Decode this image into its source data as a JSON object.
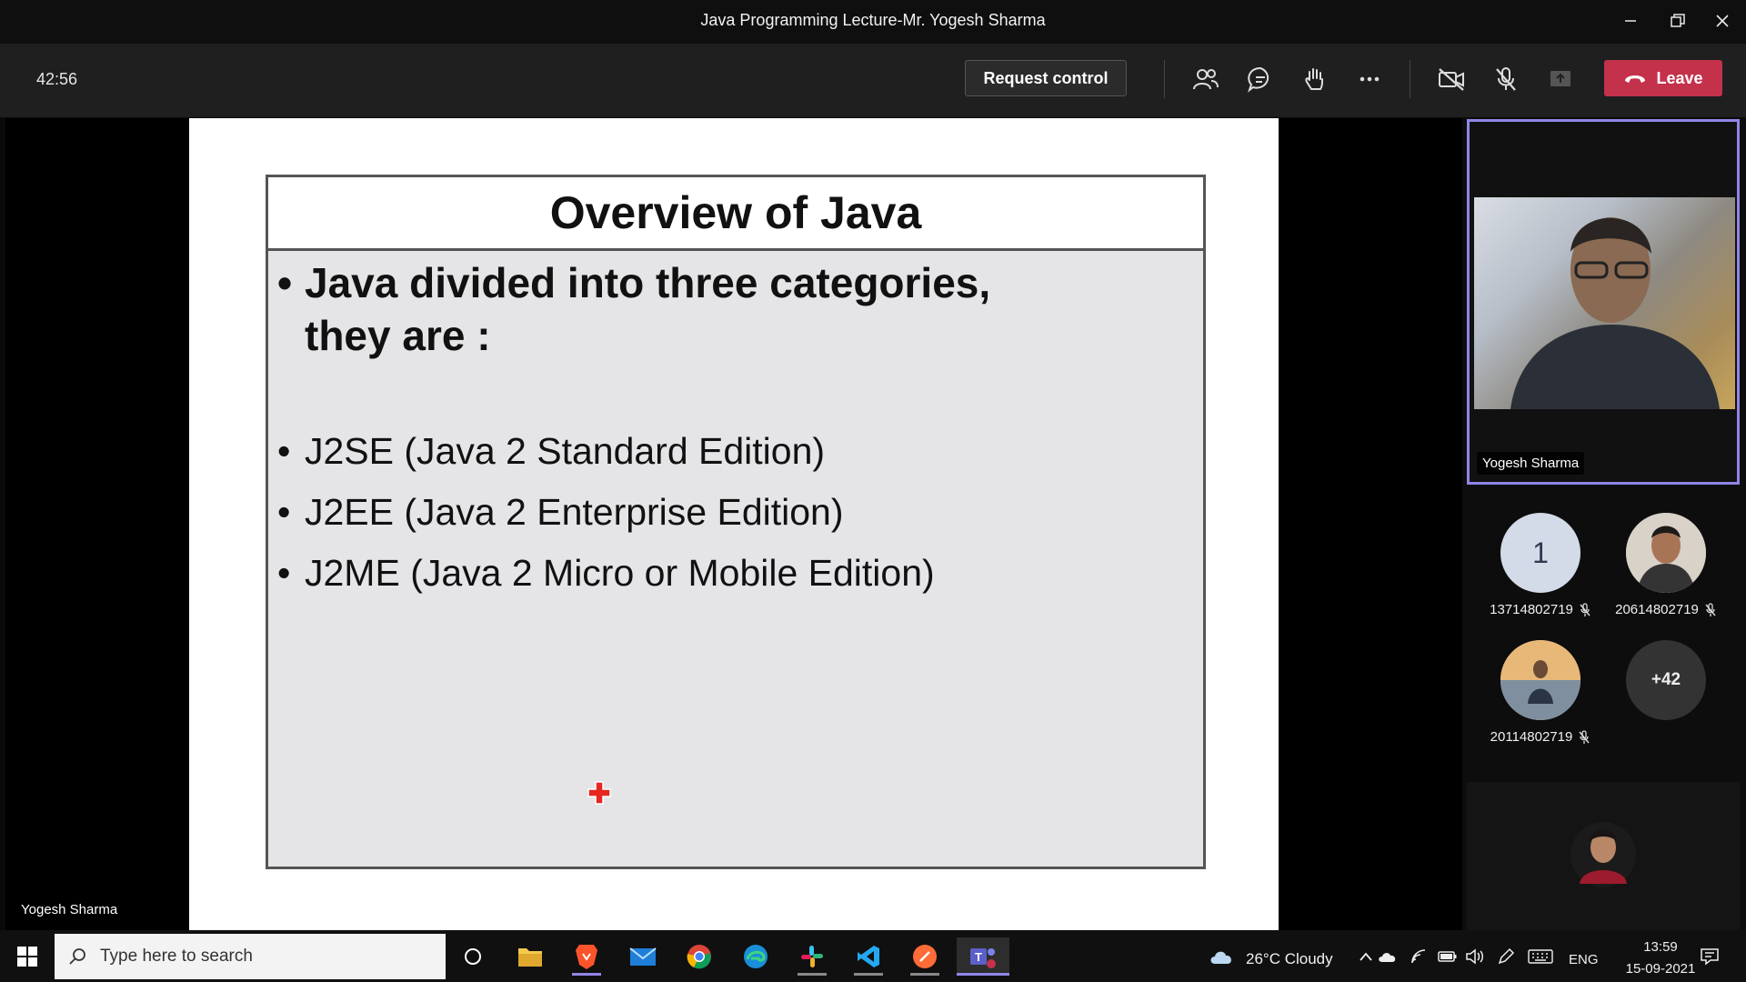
{
  "window": {
    "title": "Java Programming Lecture-Mr. Yogesh Sharma"
  },
  "toolbar": {
    "timer": "42:56",
    "request_control_label": "Request control",
    "leave_label": "Leave"
  },
  "slide": {
    "title": "Overview of Java",
    "main_bullet_line1": "Java divided into three categories,",
    "main_bullet_line2": "they are :",
    "items": [
      "J2SE (Java 2 Standard Edition)",
      "J2EE (Java 2 Enterprise Edition)",
      "J2ME (Java 2 Micro or Mobile Edition)"
    ]
  },
  "stage": {
    "presenter_name": "Yogesh Sharma"
  },
  "panel": {
    "video_tile_name": "Yogesh Sharma",
    "participants": [
      {
        "name": "13714802719",
        "avatar_text": "1"
      },
      {
        "name": "20614802719"
      },
      {
        "name": "20114802719"
      }
    ],
    "more_count": "+42"
  },
  "taskbar": {
    "search_placeholder": "Type here to search",
    "weather": "26°C  Cloudy",
    "language": "ENG",
    "time": "13:59",
    "date": "15-09-2021"
  },
  "colors": {
    "leave": "#c4314b",
    "active_tile_border": "#8f86e8",
    "toolbar_bg": "#1f1f1f"
  }
}
